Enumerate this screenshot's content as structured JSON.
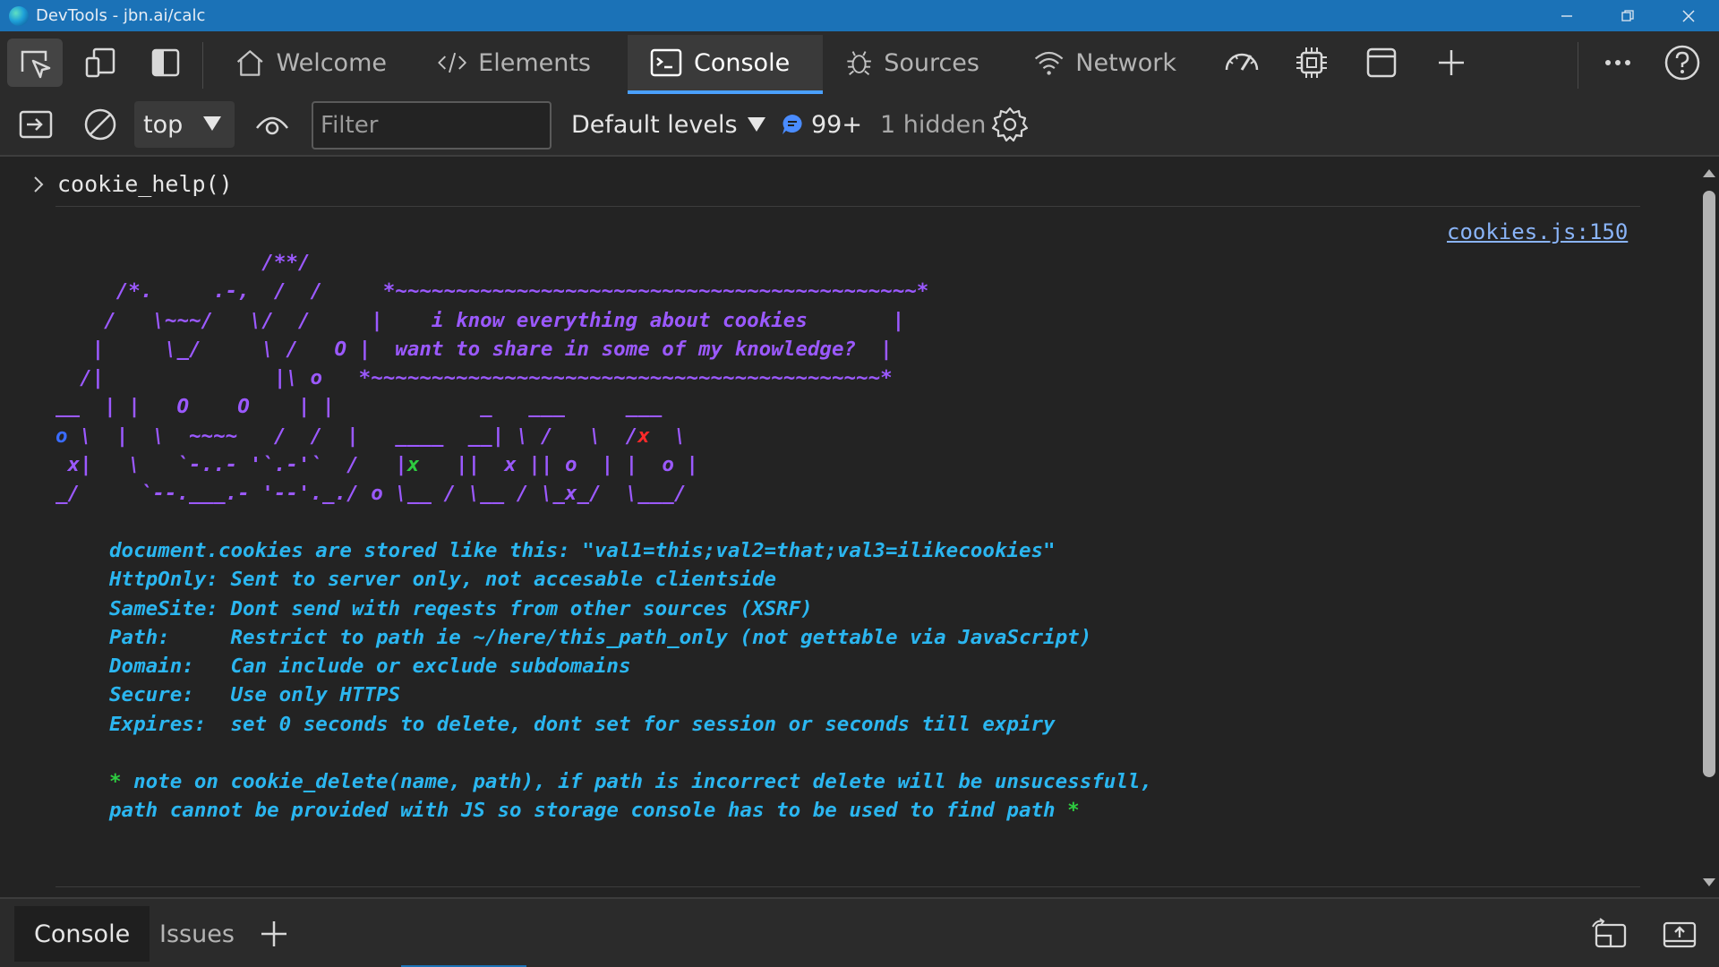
{
  "window": {
    "title": "DevTools - jbn.ai/calc"
  },
  "toolbar": {
    "tabs": [
      {
        "label": "Welcome",
        "icon": "home-icon"
      },
      {
        "label": "Elements",
        "icon": "code-icon"
      },
      {
        "label": "Console",
        "icon": "console-icon",
        "active": true
      },
      {
        "label": "Sources",
        "icon": "bug-icon"
      },
      {
        "label": "Network",
        "icon": "wifi-icon"
      }
    ],
    "icons": [
      "inspect-icon",
      "device-emulation-icon",
      "dock-side-icon",
      "performance-icon",
      "memory-icon",
      "application-icon",
      "add-tab-icon",
      "more-icon",
      "help-icon"
    ]
  },
  "console_toolbar": {
    "context": "top",
    "filter_placeholder": "Filter",
    "filter_value": "",
    "levels": "Default levels",
    "message_count": "99+",
    "hidden": "1 hidden"
  },
  "console": {
    "command": "cookie_help()",
    "source_link": "cookies.js:150",
    "art": {
      "l1": "                 /**/",
      "l2a": "     /*.     .-,  /  /     *",
      "l2b": "~~~~~~~~~~~~~~~~~~~~~~~~~~~~~~~~~~~~~~~~~~~",
      "l2c": "*",
      "l3": "    /   \\~~~/   \\/  /     |    i know everything about cookies       |",
      "l4": "   |     \\_/     \\ /   O |  want to share in some of my knowledge?  |",
      "l5a": "  /|              |\\ o   *",
      "l5b": "~~~~~~~~~~~~~~~~~~~~~~~~~~~~~~~~~~~~~~~~~~",
      "l5c": "*",
      "l6": "__  | |   O    O    | |            _   ___     ___",
      "l7a": "o",
      "l7b": " \\  |  \\  ~~~~   /  /  |   ____  __| \\ /   \\  /",
      "l7c": "x",
      "l7d": "  \\",
      "l8a": " x|   \\   `-..- '`.-'`  /   |",
      "l8b": "x",
      "l8c": "   ||  x || o  | |  o |",
      "l9": "_/     `--.___.- '--'._./ o \\__ / \\__ / \\_x_/  \\___/"
    },
    "info_lines": [
      "document.cookies are stored like this: \"val1=this;val2=that;val3=ilikecookies\"",
      "HttpOnly: Sent to server only, not accesable clientside",
      "SameSite: Dont send with reqests from other sources (XSRF)",
      "Path:     Restrict to path ie ~/here/this_path_only (not gettable via JavaScript)",
      "Domain:   Can include or exclude subdomains",
      "Secure:   Use only HTTPS",
      "Expires:  set 0 seconds to delete, dont set for session or seconds till expiry"
    ],
    "note": {
      "star": "*",
      "line1": " note on cookie_delete(name, path), if path is incorrect delete will be unsucessfull,",
      "line2": "path cannot be provided with JS so storage console has to be used to find path ",
      "star_end": "*"
    }
  },
  "drawer": {
    "tabs": [
      {
        "label": "Console",
        "active": true
      },
      {
        "label": "Issues"
      }
    ]
  },
  "colors": {
    "titlebar": "#1b72b7",
    "ascii_purple": "#9b59ff",
    "info_cyan": "#2bb6f0",
    "note_green": "#2ecc40",
    "accent_blue": "#4aa0ff",
    "red_x": "#ff2a2a",
    "blue_o": "#3a6cff"
  }
}
